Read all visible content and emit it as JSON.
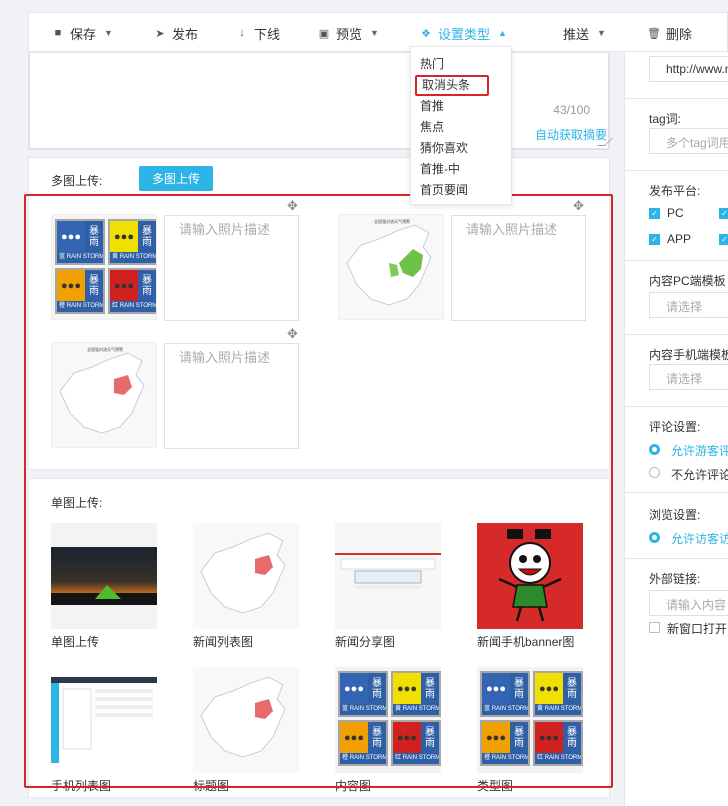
{
  "toolbar": {
    "save": "保存",
    "publish": "发布",
    "offline": "下线",
    "preview": "预览",
    "set_type": "设置类型",
    "push": "推送",
    "delete": "删除"
  },
  "type_menu": [
    "热门",
    "取消头条",
    "首推",
    "焦点",
    "猜你喜欢",
    "首推-中",
    "首页要闻"
  ],
  "summary": {
    "counter": "43/100",
    "auto_link": "自动获取摘要"
  },
  "multi": {
    "label": "多图上传:",
    "button": "多图上传",
    "desc_placeholder": "请输入照片描述"
  },
  "single": {
    "label": "单图上传:",
    "captions": [
      "单图上传",
      "新闻列表图",
      "新闻分享图",
      "新闻手机banner图",
      "手机列表图",
      "标题图",
      "内容图",
      "类型图"
    ]
  },
  "rain_badges": {
    "char_top": "暴",
    "char_bottom": "雨",
    "en": "RAIN STORM",
    "levels": [
      {
        "cn": "蓝",
        "color": "#3464b4"
      },
      {
        "cn": "黄",
        "color": "#f0e000"
      },
      {
        "cn": "橙",
        "color": "#f0a000"
      },
      {
        "cn": "红",
        "color": "#d02020"
      }
    ]
  },
  "map_title": "全国强对流天气预警",
  "sidebar": {
    "url_value": "http://www.m",
    "tag_label": "tag词:",
    "tag_placeholder": "多个tag词用",
    "platform_label": "发布平台:",
    "platform_pc": "PC",
    "platform_app": "APP",
    "pc_template_label": "内容PC端模板",
    "select_placeholder": "请选择",
    "mobile_template_label": "内容手机端模板",
    "comment_label": "评论设置:",
    "comment_allow": "允许游客评",
    "comment_deny": "不允许评论",
    "browse_label": "浏览设置:",
    "browse_allow": "允许访客访",
    "external_label": "外部链接:",
    "external_placeholder": "请输入内容",
    "new_window": "新窗口打开"
  },
  "colors": {
    "accent": "#2cb4e6",
    "highlight": "#d7252a"
  }
}
